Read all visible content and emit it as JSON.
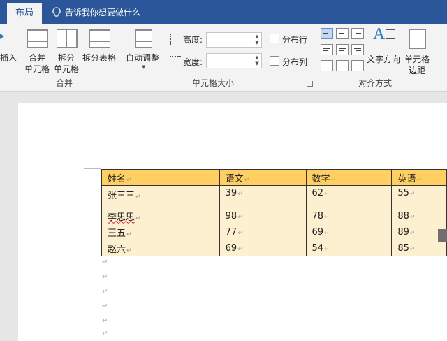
{
  "ribbon": {
    "active_tab": "布局",
    "tell_me": "告诉我你想要做什么",
    "insert_label": "插入",
    "merge_cells": [
      "合并",
      "单元格"
    ],
    "split_cells": [
      "拆分",
      "单元格"
    ],
    "split_table": "拆分表格",
    "group_merge": "合并",
    "autofit": "自动调整",
    "height_label": "高度:",
    "width_label": "宽度:",
    "height_value": "",
    "width_value": "",
    "distribute_rows": "分布行",
    "distribute_cols": "分布列",
    "group_cell_size": "单元格大小",
    "text_direction": "文字方向",
    "cell_margins": [
      "单元格",
      "边距"
    ],
    "group_alignment": "对齐方式"
  },
  "table": {
    "headers": [
      "姓名",
      "语文",
      "数学",
      "英语"
    ],
    "rows": [
      [
        "张三三",
        "39",
        "62",
        "55"
      ],
      [
        "李思思",
        "98",
        "78",
        "88"
      ],
      [
        "王五",
        "77",
        "69",
        "89"
      ],
      [
        "赵六",
        "69",
        "54",
        "85"
      ]
    ]
  },
  "colors": {
    "accent": "#2b579a",
    "header_fill": "#ffcf61",
    "row_fill": "#fdf0d0"
  }
}
